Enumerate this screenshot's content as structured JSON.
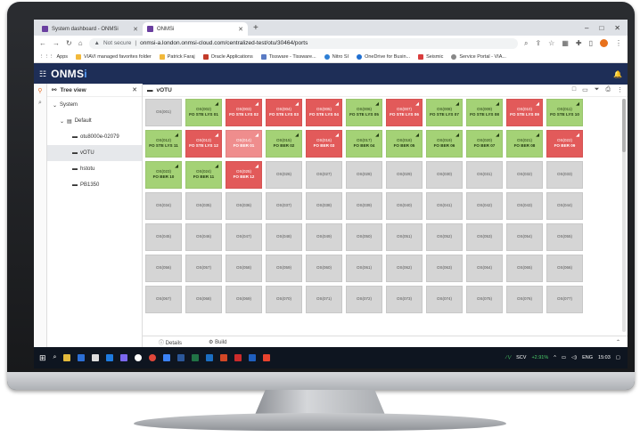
{
  "browser": {
    "tabs": [
      {
        "label": "System dashboard - ONMSi",
        "active": false
      },
      {
        "label": "ONMSi",
        "active": true
      }
    ],
    "new_tab": "+",
    "window_controls": [
      "–",
      "□",
      "✕"
    ],
    "security_label": "Not secure",
    "url": "onmsi-a.london.onmsi-cloud.com/centralized-test/otu/30464/ports",
    "avatar_letter": "P",
    "bookmarks": [
      {
        "label": "Apps",
        "color": "#5f6368"
      },
      {
        "label": "VIAVI managed favorites folder",
        "color": "#f2b93b"
      },
      {
        "label": "Patrick Faraj",
        "color": "#f2b93b"
      },
      {
        "label": "Oracle Applications",
        "color": "#c33b2a"
      },
      {
        "label": "Tissware - Tissware...",
        "color": "#5a7bc4"
      },
      {
        "label": "Nitro SI",
        "color": "#2d7fd5"
      },
      {
        "label": "OneDrive for Busin...",
        "color": "#1f6fd1"
      },
      {
        "label": "Seismic",
        "color": "#d93d3d"
      },
      {
        "label": "Service Portal - VIA...",
        "color": "#888888"
      }
    ]
  },
  "app": {
    "logo_main": "ONMS",
    "logo_accent": "i",
    "tree": {
      "title": "Tree view",
      "nodes": [
        {
          "label": "System",
          "level": 0,
          "selected": false
        },
        {
          "label": "Default",
          "level": 1,
          "selected": false
        },
        {
          "label": "otu8000e-02079",
          "level": 2,
          "selected": false
        },
        {
          "label": "vOTU",
          "level": 2,
          "selected": true
        },
        {
          "label": "hstotu",
          "level": 2,
          "selected": false
        },
        {
          "label": "PB1350",
          "level": 2,
          "selected": false
        }
      ]
    },
    "content_title": "vOTU",
    "footer": {
      "details": "Details",
      "build": "Build"
    }
  },
  "ports": [
    {
      "id": "OS(001)",
      "label": "",
      "status": "grey"
    },
    {
      "id": "OS(002)",
      "label": "FO STE LYS 01",
      "status": "green"
    },
    {
      "id": "OS(003)",
      "label": "FO STE LYS 02",
      "status": "red"
    },
    {
      "id": "OS(004)",
      "label": "FO STE LYS 03",
      "status": "red"
    },
    {
      "id": "OS(005)",
      "label": "FO STE LYS 04",
      "status": "red"
    },
    {
      "id": "OS(006)",
      "label": "FO STE LYS 05",
      "status": "green"
    },
    {
      "id": "OS(007)",
      "label": "FO STE LYS 06",
      "status": "red"
    },
    {
      "id": "OS(008)",
      "label": "FO STE LYS 07",
      "status": "green"
    },
    {
      "id": "OS(009)",
      "label": "FO STE LYS 08",
      "status": "green"
    },
    {
      "id": "OS(010)",
      "label": "FO STE LYS 09",
      "status": "red"
    },
    {
      "id": "OS(011)",
      "label": "FO STE LYS 10",
      "status": "green"
    },
    {
      "id": "OS(012)",
      "label": "FO STE LYS 11",
      "status": "green"
    },
    {
      "id": "OS(013)",
      "label": "FO STE LYS 12",
      "status": "red"
    },
    {
      "id": "OS(014)",
      "label": "FO BER 01",
      "status": "red-soft"
    },
    {
      "id": "OS(015)",
      "label": "FO BER 02",
      "status": "green"
    },
    {
      "id": "OS(016)",
      "label": "FO BER 03",
      "status": "red"
    },
    {
      "id": "OS(017)",
      "label": "FO BER 04",
      "status": "green"
    },
    {
      "id": "OS(018)",
      "label": "FO BER 05",
      "status": "green"
    },
    {
      "id": "OS(019)",
      "label": "FO BER 06",
      "status": "green"
    },
    {
      "id": "OS(020)",
      "label": "FO BER 07",
      "status": "green"
    },
    {
      "id": "OS(021)",
      "label": "FO BER 08",
      "status": "green"
    },
    {
      "id": "OS(022)",
      "label": "FO BER 09",
      "status": "red"
    },
    {
      "id": "OS(023)",
      "label": "FO BER 10",
      "status": "green"
    },
    {
      "id": "OS(024)",
      "label": "FO BER 11",
      "status": "green"
    },
    {
      "id": "OS(025)",
      "label": "FO BER 12",
      "status": "red"
    },
    {
      "id": "OS(026)",
      "label": "",
      "status": "grey"
    },
    {
      "id": "OS(027)",
      "label": "",
      "status": "grey"
    },
    {
      "id": "OS(028)",
      "label": "",
      "status": "grey"
    },
    {
      "id": "OS(029)",
      "label": "",
      "status": "grey"
    },
    {
      "id": "OS(030)",
      "label": "",
      "status": "grey"
    },
    {
      "id": "OS(031)",
      "label": "",
      "status": "grey"
    },
    {
      "id": "OS(032)",
      "label": "",
      "status": "grey"
    },
    {
      "id": "OS(033)",
      "label": "",
      "status": "grey"
    },
    {
      "id": "OS(034)",
      "label": "",
      "status": "grey"
    },
    {
      "id": "OS(035)",
      "label": "",
      "status": "grey"
    },
    {
      "id": "OS(036)",
      "label": "",
      "status": "grey"
    },
    {
      "id": "OS(037)",
      "label": "",
      "status": "grey"
    },
    {
      "id": "OS(038)",
      "label": "",
      "status": "grey"
    },
    {
      "id": "OS(039)",
      "label": "",
      "status": "grey"
    },
    {
      "id": "OS(040)",
      "label": "",
      "status": "grey"
    },
    {
      "id": "OS(041)",
      "label": "",
      "status": "grey"
    },
    {
      "id": "OS(042)",
      "label": "",
      "status": "grey"
    },
    {
      "id": "OS(043)",
      "label": "",
      "status": "grey"
    },
    {
      "id": "OS(044)",
      "label": "",
      "status": "grey"
    },
    {
      "id": "OS(045)",
      "label": "",
      "status": "grey"
    },
    {
      "id": "OS(046)",
      "label": "",
      "status": "grey"
    },
    {
      "id": "OS(047)",
      "label": "",
      "status": "grey"
    },
    {
      "id": "OS(048)",
      "label": "",
      "status": "grey"
    },
    {
      "id": "OS(049)",
      "label": "",
      "status": "grey"
    },
    {
      "id": "OS(050)",
      "label": "",
      "status": "grey"
    },
    {
      "id": "OS(051)",
      "label": "",
      "status": "grey"
    },
    {
      "id": "OS(052)",
      "label": "",
      "status": "grey"
    },
    {
      "id": "OS(053)",
      "label": "",
      "status": "grey"
    },
    {
      "id": "OS(054)",
      "label": "",
      "status": "grey"
    },
    {
      "id": "OS(055)",
      "label": "",
      "status": "grey"
    },
    {
      "id": "OS(056)",
      "label": "",
      "status": "grey"
    },
    {
      "id": "OS(057)",
      "label": "",
      "status": "grey"
    },
    {
      "id": "OS(058)",
      "label": "",
      "status": "grey"
    },
    {
      "id": "OS(059)",
      "label": "",
      "status": "grey"
    },
    {
      "id": "OS(060)",
      "label": "",
      "status": "grey"
    },
    {
      "id": "OS(061)",
      "label": "",
      "status": "grey"
    },
    {
      "id": "OS(062)",
      "label": "",
      "status": "grey"
    },
    {
      "id": "OS(063)",
      "label": "",
      "status": "grey"
    },
    {
      "id": "OS(064)",
      "label": "",
      "status": "grey"
    },
    {
      "id": "OS(065)",
      "label": "",
      "status": "grey"
    },
    {
      "id": "OS(066)",
      "label": "",
      "status": "grey"
    },
    {
      "id": "OS(067)",
      "label": "",
      "status": "grey"
    },
    {
      "id": "OS(068)",
      "label": "",
      "status": "grey"
    },
    {
      "id": "OS(069)",
      "label": "",
      "status": "grey"
    },
    {
      "id": "OS(070)",
      "label": "",
      "status": "grey"
    },
    {
      "id": "OS(071)",
      "label": "",
      "status": "grey"
    },
    {
      "id": "OS(072)",
      "label": "",
      "status": "grey"
    },
    {
      "id": "OS(073)",
      "label": "",
      "status": "grey"
    },
    {
      "id": "OS(074)",
      "label": "",
      "status": "grey"
    },
    {
      "id": "OS(075)",
      "label": "",
      "status": "grey"
    },
    {
      "id": "OS(076)",
      "label": "",
      "status": "grey"
    },
    {
      "id": "OS(077)",
      "label": "",
      "status": "grey"
    }
  ],
  "taskbar": {
    "ticker": "SCV",
    "ticker_change": "+2.91%",
    "language": "ENG",
    "time": "15:03"
  },
  "colors": {
    "appbar": "#1e2e57",
    "port_green": "#a4d276",
    "port_red": "#e25a5a",
    "port_grey": "#d5d5d5"
  }
}
